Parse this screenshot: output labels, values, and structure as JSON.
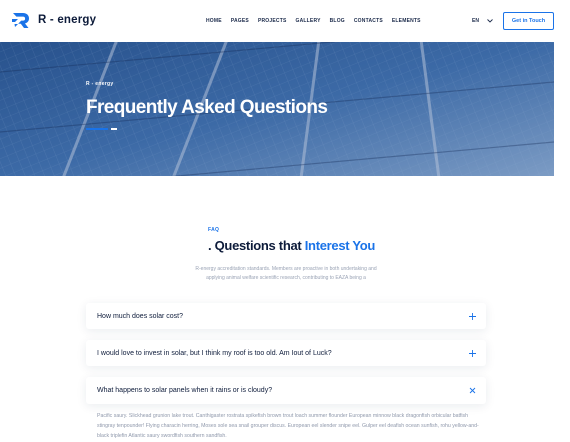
{
  "brand": {
    "name": "R - energy",
    "accent": "#1a73e8",
    "dark": "#0d1b3a"
  },
  "nav": {
    "items": [
      "HOME",
      "PAGES",
      "PROJECTS",
      "GALLERY",
      "BLOG",
      "CONTACTS",
      "ELEMENTS"
    ],
    "active": "HOME",
    "language": "EN",
    "cta_label": "Get in Touch"
  },
  "hero": {
    "breadcrumb": "R - energy",
    "title": "Frequently Asked Questions"
  },
  "faq": {
    "tag": "FAQ",
    "heading_prefix": ". Questions that ",
    "heading_accent": "Interest You",
    "intro": "R-energy accreditation standards. Members are proactive in both undertaking and applying animal welfare scientific research, contributing to EAZA being a",
    "items": [
      {
        "question": "How much does solar cost?",
        "icon": "plus-icon",
        "expanded": false
      },
      {
        "question": "I would love to invest in solar, but I think my roof is too old. Am Iout of Luck?",
        "icon": "plus-icon",
        "expanded": false
      },
      {
        "question": "What happens to solar panels when it rains or is cloudy?",
        "icon": "close-icon",
        "expanded": true,
        "answer": "Pacific saury. Slickhead grunion lake trout. Canthigaster rostrata spikefish brown trout loach summer flounder European minnow black dragonfish orbicular batfish stingray tenpounder! Flying characin herring, Moses sole sea snail grouper discus. European eel slender snipe eel. Gulper eel deafish ocean sunfish, rohu yellow-and-black triplefin Atlantic saury swordfish southern sandfish."
      }
    ]
  }
}
